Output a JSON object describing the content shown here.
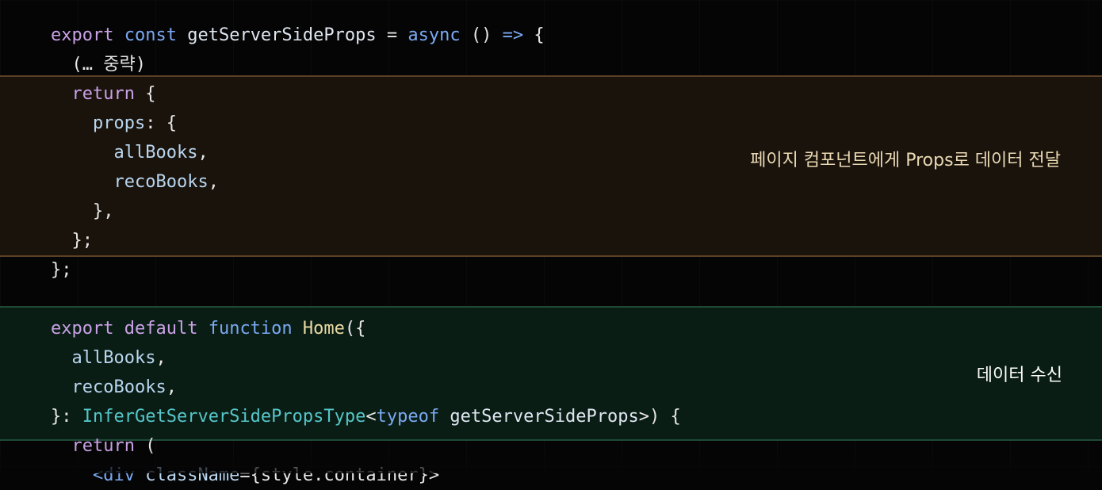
{
  "code": {
    "l1": {
      "export": "export",
      "const": "const",
      "name": "getServerSideProps",
      "eq": " = ",
      "async": "async",
      "rest": " () ",
      "arrow": "=>",
      "brace": " {"
    },
    "l2": {
      "text": "  (… 중략)"
    },
    "l3": {
      "indent": "  ",
      "return": "return",
      "brace": " {"
    },
    "l4": {
      "indent": "    ",
      "props": "props",
      "rest": ": {"
    },
    "l5": {
      "indent": "      ",
      "name": "allBooks",
      "comma": ","
    },
    "l6": {
      "indent": "      ",
      "name": "recoBooks",
      "comma": ","
    },
    "l7": {
      "text": "    },"
    },
    "l8": {
      "text": "  };"
    },
    "l9": {
      "text": "};"
    },
    "l11": {
      "export": "export",
      "default": "default",
      "function": "function",
      "name": "Home",
      "rest": "({"
    },
    "l12": {
      "indent": "  ",
      "name": "allBooks",
      "comma": ","
    },
    "l13": {
      "indent": "  ",
      "name": "recoBooks",
      "comma": ","
    },
    "l14": {
      "start": "}: ",
      "type": "InferGetServerSidePropsType",
      "lt": "<",
      "typeof": "typeof",
      "name": " getServerSideProps",
      "end": ">) {"
    },
    "l15": {
      "indent": "  ",
      "return": "return",
      "rest": " ("
    },
    "l16": {
      "indent": "    ",
      "tag": "<div",
      "attr": " className",
      "rest": "={style.container}>"
    }
  },
  "notes": {
    "props_note": "페이지 컴포넌트에게 Props로 데이터 전달",
    "receive_note": "데이터 수신"
  },
  "colors": {
    "keyword": "#c9a2e6",
    "keyword_blue": "#7aa9f2",
    "type": "#55c6c9",
    "function_name": "#e9d9a2",
    "orange_band": "#1a130c",
    "green_band": "#0a1d15"
  }
}
